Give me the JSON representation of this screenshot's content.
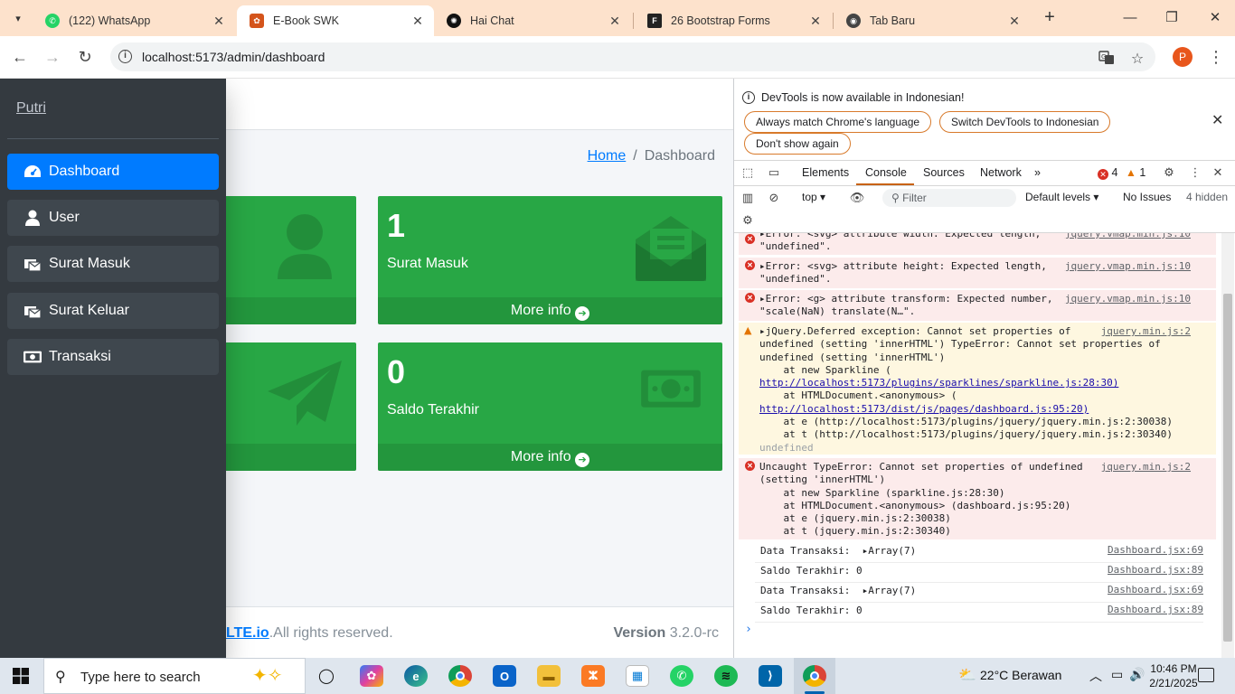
{
  "browser": {
    "tabs": [
      {
        "title": "(122) WhatsApp",
        "icon": "whatsapp-icon",
        "color": "#25d366"
      },
      {
        "title": "E-Book SWK",
        "icon": "adminlte-icon",
        "color": "#d4541b",
        "active": true
      },
      {
        "title": "Hai Chat",
        "icon": "openai-icon",
        "color": "#111111"
      },
      {
        "title": "26 Bootstrap Forms",
        "icon": "formget-icon",
        "color": "#222222"
      },
      {
        "title": "Tab Baru",
        "icon": "chrome-icon",
        "color": "#444444"
      }
    ],
    "url": "localhost:5173/admin/dashboard",
    "profile_initial": "P"
  },
  "sidebar": {
    "brand": "Putri",
    "items": [
      {
        "label": "Dashboard",
        "icon": "gauge-icon",
        "active": true
      },
      {
        "label": "User",
        "icon": "user-icon"
      },
      {
        "label": "Surat Masuk",
        "icon": "mail-inbox-icon"
      },
      {
        "label": "Surat Keluar",
        "icon": "mail-outbox-icon"
      },
      {
        "label": "Transaksi",
        "icon": "money-bill-icon"
      }
    ]
  },
  "breadcrumb": {
    "home": "Home",
    "separator": "/",
    "current": "Dashboard"
  },
  "cards": [
    {
      "value": "1",
      "label": "Surat Masuk",
      "more": "More info",
      "icon": "envelope-open-icon"
    },
    {
      "value": "0",
      "label": "Saldo Terakhir",
      "more": "More info",
      "icon": "money-bill-icon"
    }
  ],
  "hidden_cards": [
    {
      "more": "",
      "icon": "user-icon"
    },
    {
      "more": "",
      "icon": "paper-plane-icon"
    }
  ],
  "footer": {
    "link": "LTE.io",
    "rest": ".All rights reserved.",
    "version_label": "Version",
    "version": "3.2.0-rc"
  },
  "devtools": {
    "infobar": {
      "message": "DevTools is now available in Indonesian!",
      "btn1": "Always match Chrome's language",
      "btn2": "Switch DevTools to Indonesian",
      "btn3": "Don't show again"
    },
    "tabs": [
      "Elements",
      "Console",
      "Sources",
      "Network"
    ],
    "more_tabs": "»",
    "errors": "4",
    "warnings": "1",
    "context": "top",
    "filter_placeholder": "Filter",
    "levels": "Default levels",
    "issues": "No Issues",
    "hidden": "4 hidden",
    "messages": [
      {
        "type": "error",
        "lines": [
          "▸Error: <svg> attribute width: Expected length,",
          "\"undefined\"."
        ],
        "src": "jquery.vmap.min.js:10"
      },
      {
        "type": "error",
        "lines": [
          "▸Error: <svg> attribute height: Expected length,",
          "\"undefined\"."
        ],
        "src": "jquery.vmap.min.js:10"
      },
      {
        "type": "error",
        "lines": [
          "▸Error: <g> attribute transform: Expected number,",
          "\"scale(NaN) translate(N…\"."
        ],
        "src": "jquery.vmap.min.js:10"
      },
      {
        "type": "warn",
        "lines": [
          "▸jQuery.Deferred exception: Cannot set properties of",
          "undefined (setting 'innerHTML') TypeError: Cannot set properties of",
          "undefined (setting 'innerHTML')",
          "    at new Sparkline (",
          "http://localhost:5173/plugins/sparklines/sparkline.js:28:30)",
          "    at HTMLDocument.<anonymous> (",
          "http://localhost:5173/dist/js/pages/dashboard.js:95:20)",
          "    at e (http://localhost:5173/plugins/jquery/jquery.min.js:2:30038)",
          "    at t (http://localhost:5173/plugins/jquery/jquery.min.js:2:30340)",
          "undefined"
        ],
        "src": "jquery.min.js:2"
      },
      {
        "type": "error",
        "lines": [
          "Uncaught TypeError: Cannot set properties of undefined",
          "(setting 'innerHTML')",
          "    at new Sparkline (sparkline.js:28:30)",
          "    at HTMLDocument.<anonymous> (dashboard.js:95:20)",
          "    at e (jquery.min.js:2:30038)",
          "    at t (jquery.min.js:2:30340)"
        ],
        "src": "jquery.min.js:2"
      },
      {
        "type": "log",
        "lines": [
          "Data Transaksi:  ▸Array(7)"
        ],
        "src": "Dashboard.jsx:69"
      },
      {
        "type": "log",
        "lines": [
          "Saldo Terakhir: 0"
        ],
        "src": "Dashboard.jsx:89"
      },
      {
        "type": "log",
        "lines": [
          "Data Transaksi:  ▸Array(7)"
        ],
        "src": "Dashboard.jsx:69"
      },
      {
        "type": "log",
        "lines": [
          "Saldo Terakhir: 0"
        ],
        "src": "Dashboard.jsx:89"
      }
    ],
    "prompt": "›"
  },
  "taskbar": {
    "search_placeholder": "Type here to search",
    "weather": "22°C  Berawan",
    "time": "10:46 PM",
    "date": "2/21/2025",
    "apps": [
      "task-view",
      "copilot",
      "edge",
      "chrome",
      "outlook",
      "file-explorer",
      "xampp",
      "microsoft-store",
      "whatsapp",
      "spotify",
      "vscode",
      "chrome-profile"
    ]
  },
  "colors": {
    "primary": "#007bff",
    "success": "#28a745",
    "sidebar": "#343a40",
    "error": "#d93025",
    "warning": "#e37400"
  }
}
